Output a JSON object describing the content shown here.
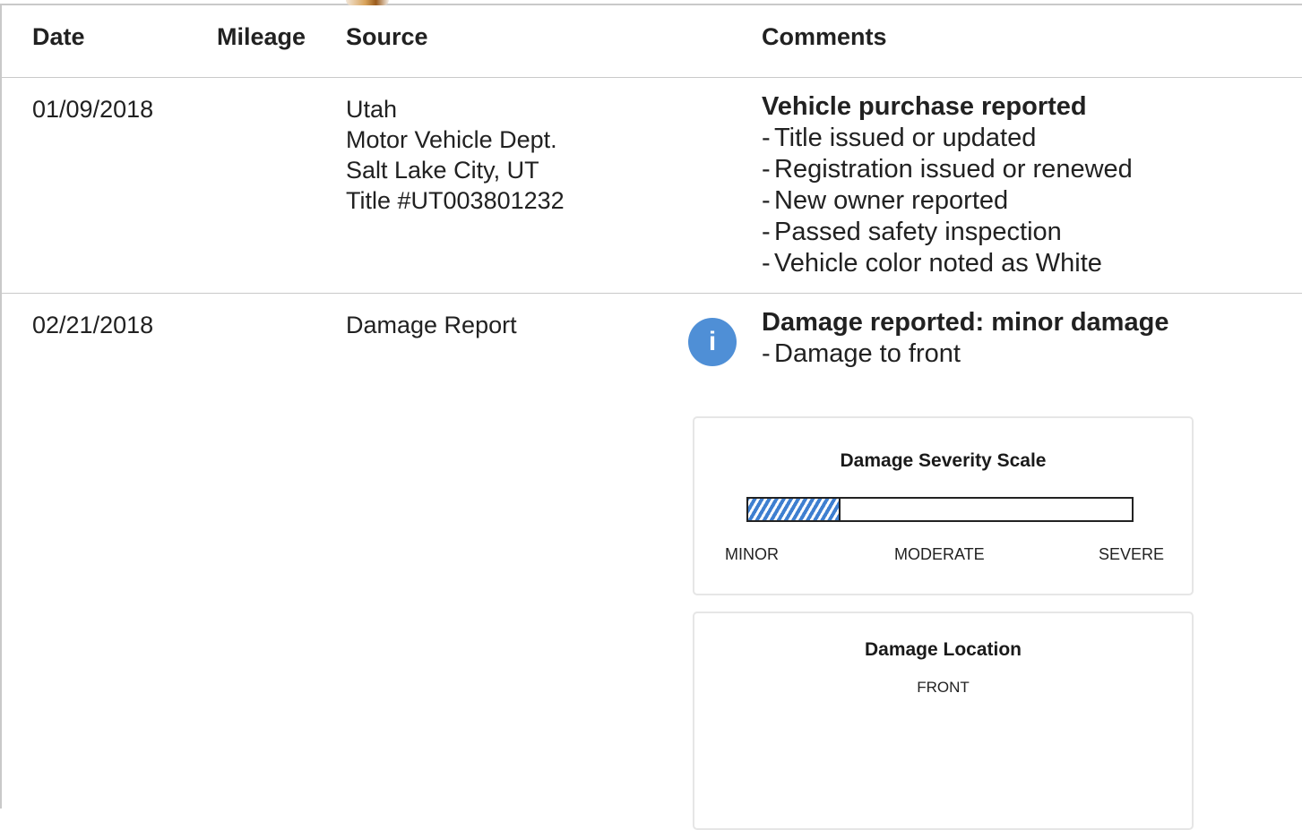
{
  "table": {
    "headers": {
      "date": "Date",
      "mileage": "Mileage",
      "source": "Source",
      "comments": "Comments"
    },
    "rows": [
      {
        "date": "01/09/2018",
        "mileage": "",
        "source": [
          "Utah",
          "Motor Vehicle Dept.",
          "Salt Lake City, UT",
          "Title #UT003801232"
        ],
        "comment_title": "Vehicle purchase reported",
        "comment_items": [
          "Title issued or updated",
          "Registration issued or renewed",
          "New owner reported",
          "Passed safety inspection",
          "Vehicle color noted as White"
        ]
      },
      {
        "date": "02/21/2018",
        "mileage": "",
        "source": [
          "Damage Report"
        ],
        "info_icon": "i",
        "comment_title": "Damage reported: minor damage",
        "comment_items": [
          "Damage to front"
        ],
        "severity": {
          "title": "Damage Severity Scale",
          "level_fraction": 0.24,
          "labels": [
            "MINOR",
            "MODERATE",
            "SEVERE"
          ],
          "fill_color": "#3e7fd0"
        },
        "location": {
          "title": "Damage Location",
          "label": "FRONT"
        }
      }
    ]
  },
  "icons": {
    "info": "info-icon"
  }
}
